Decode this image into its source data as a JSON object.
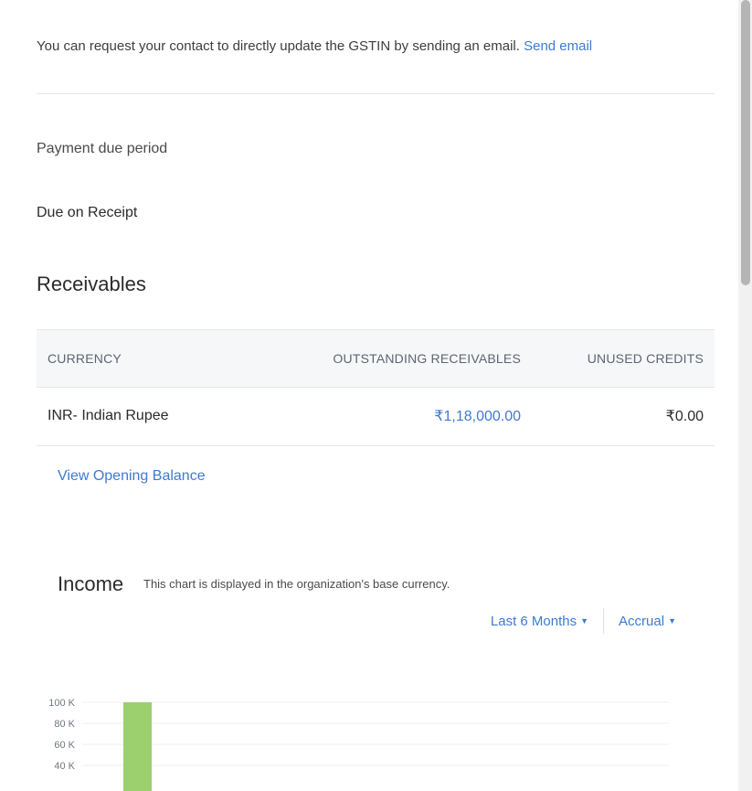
{
  "gst": {
    "message": "You can request your contact to directly update the GSTIN by sending an email.",
    "link_label": "Send email"
  },
  "payment": {
    "label": "Payment due period",
    "value": "Due on Receipt"
  },
  "receivables": {
    "title": "Receivables",
    "columns": [
      "CURRENCY",
      "OUTSTANDING RECEIVABLES",
      "UNUSED CREDITS"
    ],
    "rows": [
      {
        "currency": "INR- Indian Rupee",
        "outstanding": "₹1,18,000.00",
        "unused_credits": "₹0.00"
      }
    ],
    "opening_balance_link": "View Opening Balance"
  },
  "income": {
    "title": "Income",
    "note": "This chart is displayed in the organization's base currency.",
    "period_filter": "Last 6 Months",
    "basis_filter": "Accrual"
  },
  "colors": {
    "link": "#3f7ad0",
    "bar": "#9ccf6e"
  },
  "icons": {
    "filter_caret": "caret-down-icon"
  },
  "chart_data": {
    "type": "bar",
    "ytick_labels": [
      "100 K",
      "80 K",
      "60 K",
      "40 K"
    ],
    "yticks": [
      100000,
      80000,
      60000,
      40000
    ],
    "series": [
      {
        "values": [
          100000
        ]
      }
    ],
    "ylim_top": 100000,
    "grid": true
  }
}
